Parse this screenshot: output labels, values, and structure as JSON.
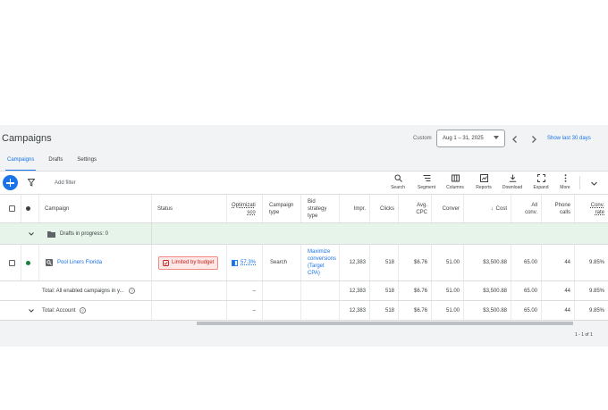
{
  "page": {
    "title": "Campaigns",
    "custom_label": "Custom",
    "date_range": "Aug 1 – 31, 2025",
    "show_last": "Show last 30 days"
  },
  "tabs": [
    {
      "label": "Campaigns",
      "active": true
    },
    {
      "label": "Drafts",
      "active": false
    },
    {
      "label": "Settings",
      "active": false
    }
  ],
  "toolbar": {
    "add_filter": "Add filter",
    "tools": [
      {
        "label": "Search",
        "icon": "search-icon"
      },
      {
        "label": "Segment",
        "icon": "segment-icon"
      },
      {
        "label": "Columns",
        "icon": "columns-icon"
      },
      {
        "label": "Reports",
        "icon": "reports-icon"
      },
      {
        "label": "Download",
        "icon": "download-icon"
      },
      {
        "label": "Expand",
        "icon": "expand-icon"
      },
      {
        "label": "More",
        "icon": "more-icon"
      }
    ]
  },
  "table": {
    "headers": {
      "campaign": "Campaign",
      "status": "Status",
      "optimization_l1": "Optimizati",
      "optimization_l2": "sco",
      "campaign_type_l1": "Campaign",
      "campaign_type_l2": "type",
      "bid_strategy_l1": "Bid",
      "bid_strategy_l2": "strategy",
      "bid_strategy_l3": "type",
      "impr": "Impr.",
      "clicks": "Clicks",
      "avg_cpc_l1": "Avg.",
      "avg_cpc_l2": "CPC",
      "conversions": "Conver",
      "cost": "Cost",
      "all_conv_l1": "All",
      "all_conv_l2": "conv.",
      "phone_calls_l1": "Phone",
      "phone_calls_l2": "calls",
      "conv_rate_l1": "Conv.",
      "conv_rate_l2": "rate"
    },
    "drafts_row": {
      "label": "Drafts in progress: 0"
    },
    "campaign_row": {
      "name": "Pool Liners Florida",
      "status": "Limited by budget",
      "optimization": "57.3%",
      "campaign_type": "Search",
      "bid_strategy_l1": "Maximize",
      "bid_strategy_l2": "conversions",
      "bid_strategy_l3": "(Target",
      "bid_strategy_l4": "CPA)",
      "impr": "12,383",
      "clicks": "518",
      "avg_cpc": "$6.76",
      "conversions": "51.00",
      "cost": "$3,500.88",
      "all_conv": "65.00",
      "phone_calls": "44",
      "conv_rate": "9.85%",
      "status_color": "#188038"
    },
    "total_enabled_row": {
      "label": "Total: All enabled campaigns in y...",
      "optimization": "–",
      "impr": "12,383",
      "clicks": "518",
      "avg_cpc": "$6.76",
      "conversions": "51.00",
      "cost": "$3,500.88",
      "all_conv": "65.00",
      "phone_calls": "44",
      "conv_rate": "9.85%"
    },
    "total_account_row": {
      "label": "Total: Account",
      "optimization": "–",
      "impr": "12,383",
      "clicks": "518",
      "avg_cpc": "$6.76",
      "conversions": "51.00",
      "cost": "$3,500.88",
      "all_conv": "65.00",
      "phone_calls": "44",
      "conv_rate": "9.85%"
    }
  },
  "pagination": "1 - 1 of 1",
  "colors": {
    "accent": "#1a73e8",
    "draft_row": "#e6f4ea",
    "error": "#c5221f"
  }
}
